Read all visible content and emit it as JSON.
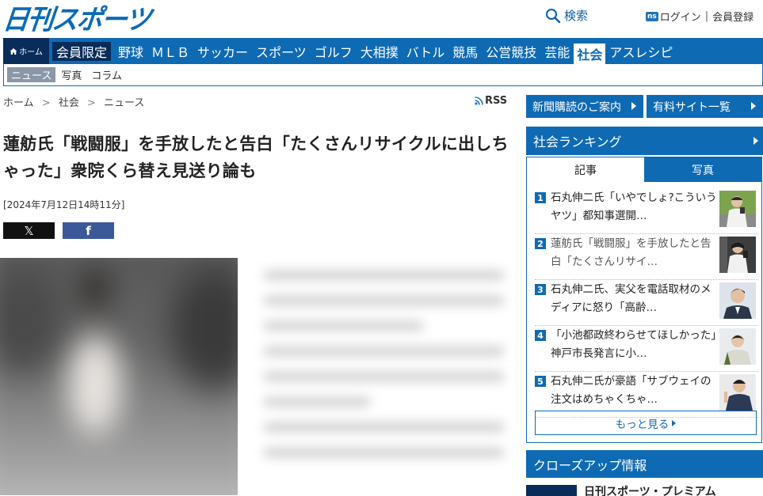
{
  "header": {
    "logo": "日刊スポーツ",
    "search_label": "検索",
    "login_badge": "ns",
    "login_label": "ログイン",
    "separator": "|",
    "register_label": "会員登録"
  },
  "nav": {
    "home_label": "ホーム",
    "items": [
      "会員限定",
      "野球",
      "ＭＬＢ",
      "サッカー",
      "スポーツ",
      "ゴルフ",
      "大相撲",
      "バトル",
      "競馬",
      "公営競技",
      "芸能",
      "社会",
      "アスレシピ"
    ],
    "active_index": 11,
    "members_index": 0
  },
  "subnav": {
    "items": [
      "ニュース",
      "写真",
      "コラム"
    ],
    "active_index": 0
  },
  "breadcrumb": {
    "items": [
      "ホーム",
      "社会",
      "ニュース"
    ],
    "separator": ">"
  },
  "rss_label": "RSS",
  "article": {
    "headline": "蓮舫氏「戦闘服」を手放したと告白「たくさんリサイクルに出しちゃった」衆院くら替え見送り論も",
    "date": "[2024年7月12日14時11分]",
    "share_x": "𝕏",
    "share_fb": "f"
  },
  "sidebar": {
    "subscribe_label": "新聞購読のご案内",
    "paid_sites_label": "有料サイト一覧",
    "ranking_title": "社会ランキング",
    "tabs": [
      "記事",
      "写真"
    ],
    "active_tab": 0,
    "ranking": [
      {
        "num": "1",
        "text": "石丸伸二氏「いやでしょ?こういうヤツ」都知事選開…"
      },
      {
        "num": "2",
        "text": "蓮舫氏「戦闘服」を手放したと告白「たくさんリサイ…"
      },
      {
        "num": "3",
        "text": "石丸伸二氏、実父を電話取材のメディアに怒り「高齢…"
      },
      {
        "num": "4",
        "text": "「小池都政終わらせてほしかった」神戸市長発言に小…"
      },
      {
        "num": "5",
        "text": "石丸伸二氏が豪語「サブウェイの注文はめちゃくちゃ…"
      }
    ],
    "more_label": "もっと見る",
    "closeup_title": "クローズアップ情報",
    "premium_label": "日刊スポーツ・プレミアム"
  },
  "colors": {
    "brand_blue": "#0f6ab4",
    "dark_navy": "#0a2c5a",
    "logo_blue": "#0a6ab8"
  }
}
